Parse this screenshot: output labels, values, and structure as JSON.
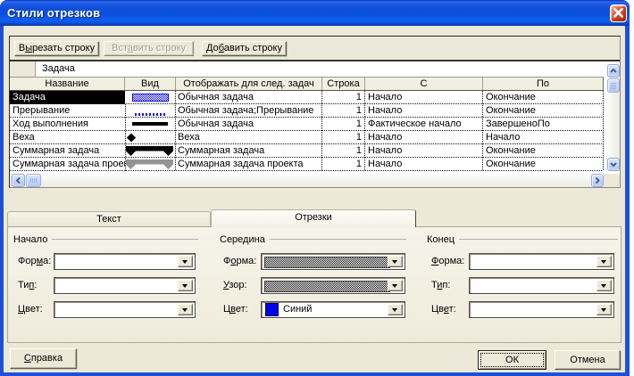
{
  "window": {
    "title": "Стили отрезков"
  },
  "colors": {
    "dialog_face": "#ece9d8",
    "titlebar_blue": "#0e50da",
    "window_border_blue": "#1c50d8",
    "close_button_red": "#d84a28",
    "selection_bg": "#000000",
    "selection_fg": "#ffffff",
    "bar_blue": "#1414e0",
    "summary_gray": "#949494",
    "color_swatch_blue": "#0000e8"
  },
  "toolbar": {
    "cut": {
      "pre": "В",
      "key": "ы",
      "post": "резать строку"
    },
    "paste": {
      "pre": "Вст",
      "key": "а",
      "post": "вить строку"
    },
    "add": {
      "pre": "До",
      "key": "б",
      "post": "авить строку"
    }
  },
  "entry_bar": {
    "value": "Задача"
  },
  "table": {
    "columns": [
      "Название",
      "Вид",
      "Отображать для след. задач",
      "Строка",
      "С",
      "По"
    ],
    "rows": [
      {
        "name": "Задача",
        "appearance": "blue-hatched-bar",
        "show_for": "Обычная задача",
        "row": "1",
        "from": "Начало",
        "to": "Окончание",
        "selected": true
      },
      {
        "name": "Прерывание",
        "appearance": "blue-dotted-line",
        "show_for": "Обычная задача;Прерывание",
        "row": "1",
        "from": "Начало",
        "to": "Окончание",
        "selected": false
      },
      {
        "name": "Ход выполнения",
        "appearance": "black-solid-line",
        "show_for": "Обычная задача",
        "row": "1",
        "from": "Фактическое начало",
        "to": "ЗавершеноПо",
        "selected": false
      },
      {
        "name": "Веха",
        "appearance": "black-diamond",
        "show_for": "Веха",
        "row": "1",
        "from": "Начало",
        "to": "Начало",
        "selected": false
      },
      {
        "name": "Суммарная задача",
        "appearance": "black-summary-bar",
        "show_for": "Суммарная задача",
        "row": "1",
        "from": "Начало",
        "to": "Окончание",
        "selected": false
      },
      {
        "name": "Суммарная задача проекта",
        "appearance": "gray-summary-bar",
        "show_for": "Суммарная задача проекта",
        "row": "1",
        "from": "Начало",
        "to": "Окончание",
        "selected": false
      }
    ]
  },
  "tabs": {
    "text": {
      "label": "Текст",
      "active": false
    },
    "bars": {
      "label": "Отрезки",
      "active": true
    }
  },
  "groups": {
    "start": {
      "label": "Начало",
      "shape": {
        "pre": "Фор",
        "key": "м",
        "post": "а:",
        "value": ""
      },
      "type": {
        "pre": "Ти",
        "key": "п",
        "post": ":",
        "value": ""
      },
      "color": {
        "pre": "",
        "key": "Ц",
        "post": "вет:",
        "value": ""
      }
    },
    "middle": {
      "label": "Середина",
      "shape": {
        "pre": "Ф",
        "key": "о",
        "post": "рма:",
        "value": "checkered-bar"
      },
      "pattern": {
        "pre": "",
        "key": "У",
        "post": "зор:",
        "value": "checkered-pattern"
      },
      "color": {
        "pre": "Ц",
        "key": "в",
        "post": "ет:",
        "value": "Синий"
      }
    },
    "end": {
      "label": "Конец",
      "shape": {
        "pre": "",
        "key": "Ф",
        "post": "орма:",
        "value": ""
      },
      "type": {
        "pre": "Т",
        "key": "и",
        "post": "п:",
        "value": ""
      },
      "color": {
        "pre": "Цв",
        "key": "е",
        "post": "т:",
        "value": ""
      }
    }
  },
  "footer": {
    "help": {
      "pre": "",
      "key": "С",
      "post": "правка"
    },
    "ok": "ОК",
    "cancel": "Отмена"
  }
}
